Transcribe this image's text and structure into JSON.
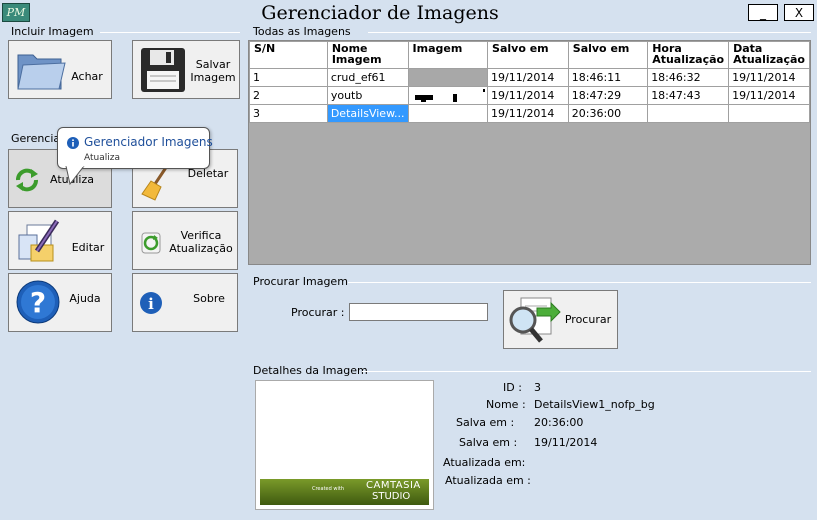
{
  "window": {
    "title": "Gerenciador de Imagens",
    "logo_text": "PM",
    "minimize_label": "_",
    "close_label": "X"
  },
  "incluir": {
    "label": "Incluir Imagem",
    "achar_label": "Achar",
    "salvar_label": "Salvar Imagem"
  },
  "gerenciar": {
    "label": "Gerenciar",
    "atualiza_label": "Atualiza",
    "deletar_label": "Deletar",
    "editar_label": "Editar",
    "verifica_label": "Verifica Atualização",
    "ajuda_label": "Ajuda",
    "sobre_label": "Sobre"
  },
  "tooltip": {
    "title": "Gerenciador Imagens",
    "text": "Atualiza"
  },
  "grid": {
    "label": "Todas as Imagens",
    "headers": [
      "S/N",
      "Nome Imagem",
      "Imagem",
      "Salvo em",
      "Salvo em",
      "Hora Atualização",
      "Data Atualização"
    ],
    "rows": [
      [
        "1",
        "crud_ef61",
        "",
        "19/11/2014",
        "18:46:11",
        "18:46:32",
        "19/11/2014"
      ],
      [
        "2",
        "youtb",
        "",
        "19/11/2014",
        "18:47:29",
        "18:47:43",
        "19/11/2014"
      ],
      [
        "3",
        "DetailsView...",
        "",
        "19/11/2014",
        "20:36:00",
        "",
        ""
      ]
    ],
    "selected_row": 2,
    "selected_col": 1
  },
  "procurar": {
    "label": "Procurar Imagem",
    "field_label": "Procurar :",
    "value": "",
    "button_label": "Procurar"
  },
  "detalhes": {
    "label": "Detalhes da Imagem",
    "fields": [
      {
        "label": "ID :",
        "value": "3"
      },
      {
        "label": "Nome :",
        "value": "DetailsView1_nofp_bg"
      },
      {
        "label": "Salva em :",
        "value": "20:36:00"
      },
      {
        "label": "Salva em :",
        "value": "19/11/2014"
      },
      {
        "label": "Atualizada em:",
        "value": ""
      },
      {
        "label": "Atualizada em :",
        "value": ""
      }
    ],
    "preview_caption": "Created with",
    "preview_brand": "CAMTASIA",
    "preview_brand2": "STUDIO"
  },
  "colors": {
    "background": "#d5e1ef",
    "selection": "#3399ff",
    "grid_empty": "#ababab"
  }
}
